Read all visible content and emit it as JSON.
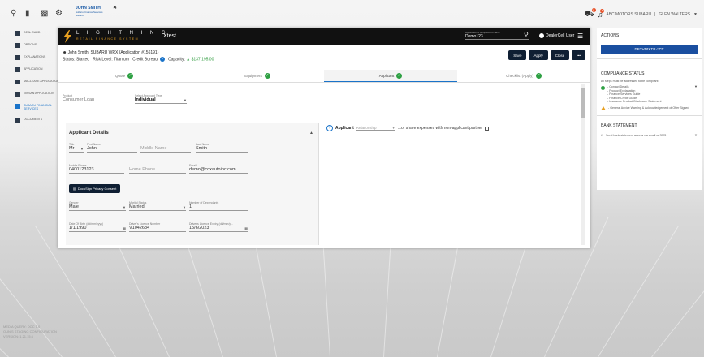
{
  "topbar": {
    "user_name": "JOHN SMITH",
    "user_sub1": "Subaru Finance Services",
    "user_sub2": "Subaru",
    "dealer": "ABC MOTORS SUBARU",
    "separator": "|",
    "user_right": "GLEN WALTERS",
    "cart_badge": "2",
    "bell_badge": "5"
  },
  "leftnav": {
    "items": [
      {
        "label": "DEAL CARD"
      },
      {
        "label": "OPTIONS"
      },
      {
        "label": "EXPLANATIONS"
      },
      {
        "label": "APPLICATION"
      },
      {
        "label": "MACLEASE APPLICATION"
      },
      {
        "label": "NISSAN APPLICATION"
      },
      {
        "label": "SUBARU FINANCIAL SERVICES"
      },
      {
        "label": "DOCUMENTS"
      }
    ],
    "version_lines": [
      "MEDIA QUERY: DOC 1.0",
      "OUNIS STAGING CONFIGURATION",
      "VERSION: 1.21.15.6"
    ]
  },
  "header": {
    "logo_text": "L I G H T N I N G",
    "logo_sub": "RETAIL FINANCE SYSTEM",
    "title": "Xtest",
    "app_search_label": "Application # or Applicant Name",
    "app_search_value": "Demo123",
    "dealer_user": "DealerCell User"
  },
  "customer": {
    "line1": "John Smith:  SUBARU WRX   (Application #156191)",
    "status": "Status: Started",
    "risk": "Risk Level: Titanium",
    "bureau": "Credit Bureau:",
    "capacity_label": "Capacity:",
    "capacity_value": "$137,195.00"
  },
  "actions": {
    "save": "Save",
    "apply": "Apply",
    "close": "Close",
    "more": "•••"
  },
  "tabs": [
    {
      "label": "Quote"
    },
    {
      "label": "Equipment"
    },
    {
      "label": "Applicant"
    },
    {
      "label": "Checklist (Apply)"
    }
  ],
  "form": {
    "product_label": "Product",
    "product_value": "Consumer Loan",
    "applicant_type_label": "Select Applicant Type",
    "applicant_type_value": "Individual",
    "panel_title": "Applicant Details",
    "title_label": "Title",
    "title_value": "Mr",
    "first_name_label": "First Name",
    "first_name_value": "John",
    "middle_name_placeholder": "Middle Name",
    "last_name_label": "Last Name",
    "last_name_value": "Smith",
    "mobile_label": "Mobile Phone",
    "mobile_value": "0400123123",
    "home_phone_placeholder": "Home Phone",
    "email_label": "Email",
    "email_value": "demo@coxautoinc.com",
    "docusign": "DocuSign Privacy Consent",
    "gender_label": "Gender",
    "gender_value": "Male",
    "marital_label": "Marital Status",
    "marital_value": "Married",
    "dependants_label": "Number of Dependants",
    "dependants_value": "1",
    "dob_label": "Date Of Birth (dd/mm/yyyy)",
    "dob_value": "1/1/1990",
    "licence_label": "Driver's Licence Number",
    "licence_value": "V1042684",
    "expiry_label": "Driver's Licence Expiry (dd/mm/y...",
    "expiry_value": "15/6/2023"
  },
  "right_form": {
    "applicant": "Applicant",
    "relationship_placeholder": "Relationship",
    "share_text": "...or share expenses with non-applicant partner"
  },
  "rightpanel": {
    "actions_title": "ACTIONS",
    "return_btn": "RETURN TO APP",
    "compliance_title": "COMPLIANCE STATUS",
    "compliance_sub": "All steps must be addressed to be compliant",
    "compliance_items": [
      "- Contact Details",
      "- Product Explanation",
      "- Finance Services Guide",
      "- Finance Credit Guide",
      "- Insurance Product Disclosure Statement"
    ],
    "warning_text": "- General Advice Warning & Acknowledgement of Offer Signed",
    "bank_title": "BANK STATEMENT",
    "bank_text": "Send bank statement access via email or SMS"
  }
}
